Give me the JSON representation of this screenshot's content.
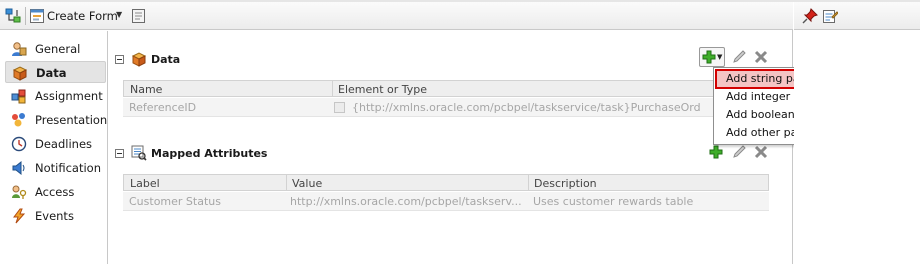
{
  "toolbar": {
    "create_form_label": "Create Form",
    "icons": [
      "hierarchy-icon",
      "form-icon",
      "chevron-down-icon",
      "preview-icon"
    ]
  },
  "sidebar": {
    "items": [
      {
        "label": "General",
        "icon": "general-icon",
        "active": false
      },
      {
        "label": "Data",
        "icon": "data-icon",
        "active": true
      },
      {
        "label": "Assignment",
        "icon": "assignment-icon",
        "active": false
      },
      {
        "label": "Presentation",
        "icon": "presentation-icon",
        "active": false
      },
      {
        "label": "Deadlines",
        "icon": "deadlines-icon",
        "active": false
      },
      {
        "label": "Notification",
        "icon": "notification-icon",
        "active": false
      },
      {
        "label": "Access",
        "icon": "access-icon",
        "active": false
      },
      {
        "label": "Events",
        "icon": "events-icon",
        "active": false
      }
    ]
  },
  "data_section": {
    "title": "Data",
    "columns": [
      "Name",
      "Element or Type"
    ],
    "rows": [
      {
        "name": "ReferenceID",
        "type": "{http://xmlns.oracle.com/pcbpel/taskservice/task}PurchaseOrd"
      }
    ]
  },
  "mapped_section": {
    "title": "Mapped Attributes",
    "columns": [
      "Label",
      "Value",
      "Description"
    ],
    "rows": [
      {
        "label": "Customer Status",
        "value": "http://xmlns.oracle.com/pcbpel/taskserv...",
        "description": "Uses customer rewards table"
      }
    ]
  },
  "add_menu": {
    "items": [
      "Add string payload",
      "Add integer payload",
      "Add boolean payload",
      "Add other payload"
    ],
    "highlighted_index": 0,
    "highlight_color": "#d30000"
  },
  "right_panel": {
    "icons": [
      "pin-icon",
      "edit-properties-icon"
    ]
  }
}
